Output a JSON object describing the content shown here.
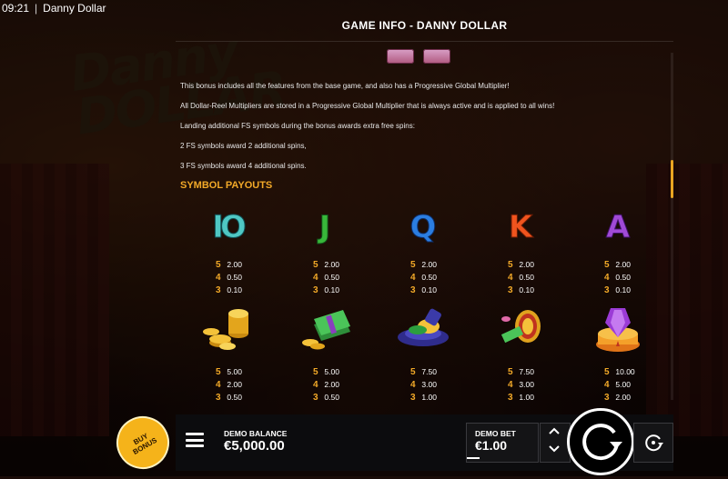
{
  "status_bar": {
    "time": "09:21",
    "separator": "|",
    "app_title": "Danny Dollar"
  },
  "panel": {
    "title": "GAME INFO - DANNY DOLLAR"
  },
  "paragraphs": [
    "This bonus includes all the features from the base game, and also has a Progressive Global Multiplier!",
    "All Dollar-Reel Multipliers are stored in a Progressive Global Multiplier that is always active and is applied to all wins!",
    "Landing additional FS symbols during the bonus awards extra free spins:",
    "2 FS symbols award 2 additional spins,",
    "3 FS symbols award 4 additional spins."
  ],
  "section_title": "SYMBOL PAYOUTS",
  "symbols": [
    {
      "name": "10",
      "glyph": "IO",
      "color": "#4fc7c3",
      "pays": [
        {
          "count": "5",
          "value": "2.00"
        },
        {
          "count": "4",
          "value": "0.50"
        },
        {
          "count": "3",
          "value": "0.10"
        }
      ]
    },
    {
      "name": "J",
      "glyph": "J",
      "color": "#38b83a",
      "pays": [
        {
          "count": "5",
          "value": "2.00"
        },
        {
          "count": "4",
          "value": "0.50"
        },
        {
          "count": "3",
          "value": "0.10"
        }
      ]
    },
    {
      "name": "Q",
      "glyph": "Q",
      "color": "#2b7de0",
      "pays": [
        {
          "count": "5",
          "value": "2.00"
        },
        {
          "count": "4",
          "value": "0.50"
        },
        {
          "count": "3",
          "value": "0.10"
        }
      ]
    },
    {
      "name": "K",
      "glyph": "K",
      "color": "#f0541e",
      "pays": [
        {
          "count": "5",
          "value": "2.00"
        },
        {
          "count": "4",
          "value": "0.50"
        },
        {
          "count": "3",
          "value": "0.10"
        }
      ]
    },
    {
      "name": "A",
      "glyph": "A",
      "color": "#a04ad6",
      "pays": [
        {
          "count": "5",
          "value": "2.00"
        },
        {
          "count": "4",
          "value": "0.50"
        },
        {
          "count": "3",
          "value": "0.10"
        }
      ]
    },
    {
      "name": "coins",
      "glyph": "",
      "color": "#f2b51e",
      "pays": [
        {
          "count": "5",
          "value": "5.00"
        },
        {
          "count": "4",
          "value": "2.00"
        },
        {
          "count": "3",
          "value": "0.50"
        }
      ]
    },
    {
      "name": "cash",
      "glyph": "",
      "color": "#3fae4a",
      "pays": [
        {
          "count": "5",
          "value": "5.00"
        },
        {
          "count": "4",
          "value": "2.00"
        },
        {
          "count": "3",
          "value": "0.50"
        }
      ]
    },
    {
      "name": "hat",
      "glyph": "",
      "color": "#3b3aa8",
      "pays": [
        {
          "count": "5",
          "value": "7.50"
        },
        {
          "count": "4",
          "value": "3.00"
        },
        {
          "count": "3",
          "value": "1.00"
        }
      ]
    },
    {
      "name": "drum",
      "glyph": "",
      "color": "#e0a21e",
      "pays": [
        {
          "count": "5",
          "value": "7.50"
        },
        {
          "count": "4",
          "value": "3.00"
        },
        {
          "count": "3",
          "value": "1.00"
        }
      ]
    },
    {
      "name": "gem",
      "glyph": "",
      "color": "#9b3bd6",
      "pays": [
        {
          "count": "5",
          "value": "10.00"
        },
        {
          "count": "4",
          "value": "5.00"
        },
        {
          "count": "3",
          "value": "2.00"
        }
      ]
    }
  ],
  "controls": {
    "buy_bonus": "BUY BONUS",
    "balance_label": "DEMO BALANCE",
    "balance_value": "€5,000.00",
    "bet_label": "DEMO BET",
    "bet_value": "€1.00"
  },
  "background": {
    "logo_text": "Danny DOLLAR"
  }
}
